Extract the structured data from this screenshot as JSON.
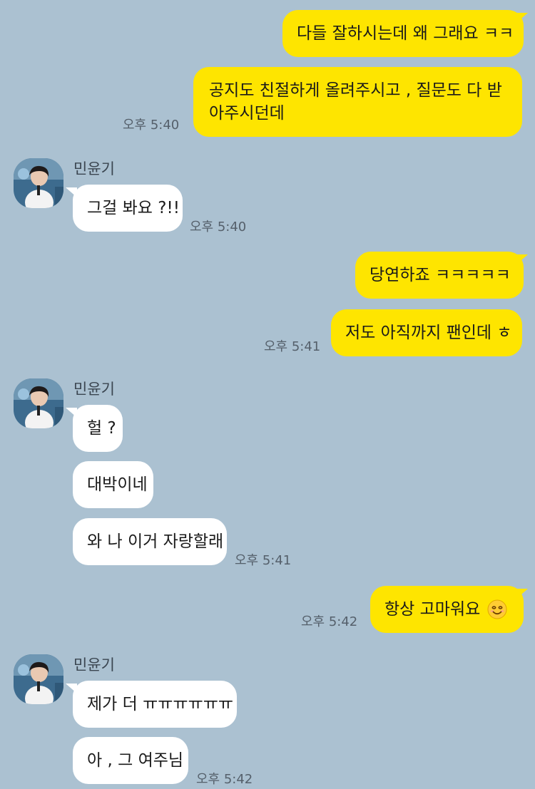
{
  "contact": {
    "name": "민윤기",
    "avatar_icon": "profile-photo"
  },
  "colors": {
    "background": "#abc1d1",
    "my_bubble": "#fee500",
    "their_bubble": "#ffffff"
  },
  "messages": {
    "m1": "다들 잘하시는데 왜 그래요 ㅋㅋ",
    "m2": "공지도 친절하게 올려주시고 , 질문도 다 받아주시던데",
    "m2_time": "오후 5:40",
    "m3": "그걸 봐요 ?!!",
    "m3_time": "오후 5:40",
    "m4": "당연하죠 ㅋㅋㅋㅋㅋ",
    "m5": "저도 아직까지 팬인데 ㅎ",
    "m5_time": "오후 5:41",
    "m6": "헐 ?",
    "m7": "대박이네",
    "m8": "와 나 이거 자랑할래",
    "m8_time": "오후 5:41",
    "m9": "항상 고마워요",
    "m9_emoji": "smiling-face-emoji",
    "m9_time": "오후 5:42",
    "m10": "제가 더 ㅠㅠㅠㅠㅠㅠ",
    "m11": "아 , 그 여주님",
    "m11_time": "오후 5:42"
  }
}
